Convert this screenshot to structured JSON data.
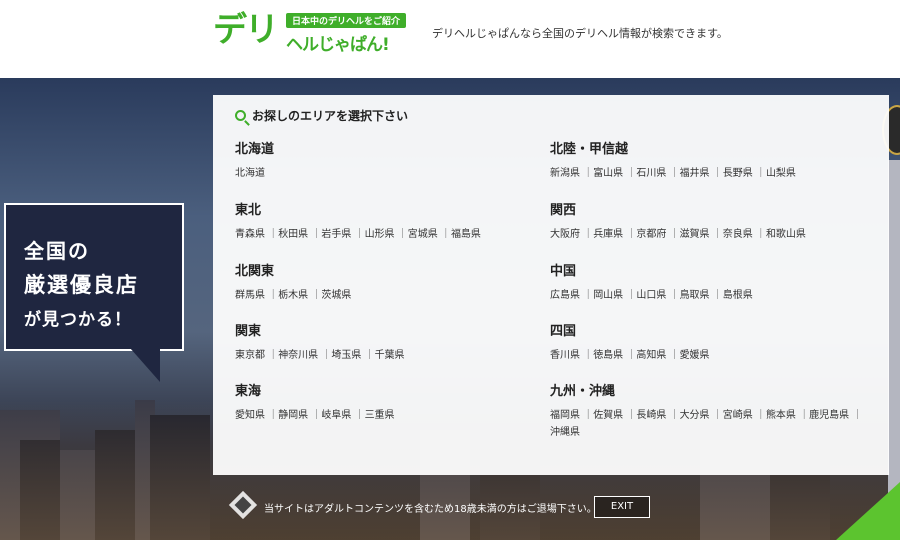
{
  "header": {
    "logo_main": "デリ",
    "logo_tagline": "日本中のデリヘルをご紹介",
    "logo_sub": "ヘルじゃぱん!",
    "description": "デリヘルじゃぱんなら全国のデリヘル情報が検索できます。"
  },
  "hero": {
    "bubble_lines": [
      "全国の",
      "厳選優良店",
      "が見つかる！"
    ]
  },
  "area_panel": {
    "title": "お探しのエリアを選択下さい",
    "search_icon": "search-icon",
    "left_regions": [
      {
        "name": "北海道",
        "prefs": [
          "北海道"
        ]
      },
      {
        "name": "東北",
        "prefs": [
          "青森県",
          "秋田県",
          "岩手県",
          "山形県",
          "宮城県",
          "福島県"
        ]
      },
      {
        "name": "北関東",
        "prefs": [
          "群馬県",
          "栃木県",
          "茨城県"
        ]
      },
      {
        "name": "関東",
        "prefs": [
          "東京都",
          "神奈川県",
          "埼玉県",
          "千葉県"
        ]
      },
      {
        "name": "東海",
        "prefs": [
          "愛知県",
          "静岡県",
          "岐阜県",
          "三重県"
        ]
      }
    ],
    "right_regions": [
      {
        "name": "北陸・甲信越",
        "prefs": [
          "新潟県",
          "富山県",
          "石川県",
          "福井県",
          "長野県",
          "山梨県"
        ]
      },
      {
        "name": "関西",
        "prefs": [
          "大阪府",
          "兵庫県",
          "京都府",
          "滋賀県",
          "奈良県",
          "和歌山県"
        ]
      },
      {
        "name": "中国",
        "prefs": [
          "広島県",
          "岡山県",
          "山口県",
          "鳥取県",
          "島根県"
        ]
      },
      {
        "name": "四国",
        "prefs": [
          "香川県",
          "徳島県",
          "高知県",
          "愛媛県"
        ]
      },
      {
        "name": "九州・沖縄",
        "prefs": [
          "福岡県",
          "佐賀県",
          "長崎県",
          "大分県",
          "宮崎県",
          "熊本県",
          "鹿児島県",
          "沖縄県"
        ]
      }
    ]
  },
  "warning": {
    "text": "当サイトはアダルトコンテンツを含むため18歳未満の方はご退場下さい。",
    "exit_label": "EXIT"
  },
  "colors": {
    "brand_green": "#3fae2a",
    "navy": "#1f2640"
  }
}
